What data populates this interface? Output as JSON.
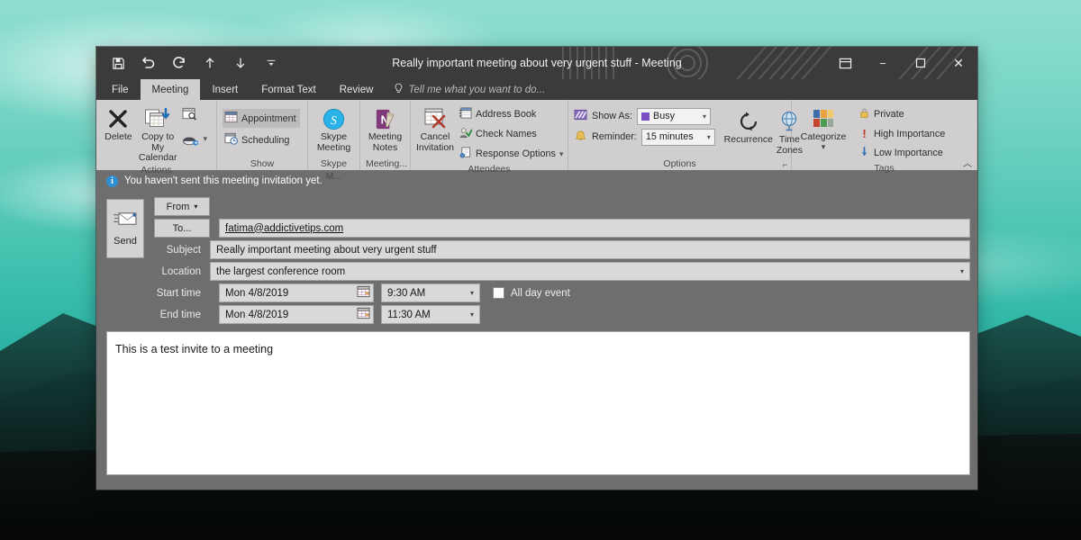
{
  "window": {
    "title": "Really important meeting about very urgent stuff - Meeting",
    "controls": {
      "ribbon_display_icon": "ribbon-display-options-icon",
      "minimize": "−",
      "maximize": "▢",
      "close": "✕"
    }
  },
  "quick_access": [
    {
      "name": "save-icon",
      "glyph": "save"
    },
    {
      "name": "undo-icon",
      "glyph": "undo"
    },
    {
      "name": "redo-icon",
      "glyph": "redo"
    },
    {
      "name": "previous-item-icon",
      "glyph": "up"
    },
    {
      "name": "next-item-icon",
      "glyph": "down"
    },
    {
      "name": "customize-quick-access-toolbar-icon",
      "glyph": "chevron"
    }
  ],
  "tabs": [
    {
      "label": "File",
      "active": false
    },
    {
      "label": "Meeting",
      "active": true
    },
    {
      "label": "Insert",
      "active": false
    },
    {
      "label": "Format Text",
      "active": false
    },
    {
      "label": "Review",
      "active": false
    }
  ],
  "tell_me": {
    "placeholder": "Tell me what you want to do..."
  },
  "ribbon": {
    "groups": [
      {
        "label": "Actions",
        "buttons": [
          {
            "label": "Delete",
            "icon": "delete-x-icon"
          },
          {
            "label": "Copy to My Calendar",
            "icon": "copy-to-calendar-icon"
          }
        ],
        "small": [
          {
            "label": "",
            "icon": "calendar-search-icon"
          },
          {
            "label": "",
            "icon": "forward-meeting-icon"
          }
        ]
      },
      {
        "label": "Show",
        "small": [
          {
            "label": "Appointment",
            "icon": "appointment-icon",
            "selected": true
          },
          {
            "label": "Scheduling",
            "icon": "scheduling-icon",
            "selected": false
          }
        ]
      },
      {
        "label": "Skype M...",
        "buttons": [
          {
            "label": "Skype Meeting",
            "icon": "skype-icon"
          }
        ]
      },
      {
        "label": "Meeting...",
        "buttons": [
          {
            "label": "Meeting Notes",
            "icon": "onenote-icon"
          }
        ]
      },
      {
        "label": "Attendees",
        "buttons": [
          {
            "label": "Cancel Invitation",
            "icon": "cancel-invitation-icon"
          }
        ],
        "small": [
          {
            "label": "Address Book",
            "icon": "address-book-icon"
          },
          {
            "label": "Check Names",
            "icon": "check-names-icon"
          },
          {
            "label": "Response Options",
            "icon": "response-options-icon",
            "dropdown": true
          }
        ]
      },
      {
        "label": "Options",
        "show_as": {
          "label": "Show As:",
          "value": "Busy",
          "icon": "show-as-icon",
          "swatch_color": "#7a4fc4"
        },
        "reminder": {
          "label": "Reminder:",
          "value": "15 minutes",
          "icon": "reminder-bell-icon"
        },
        "buttons": [
          {
            "label": "Recurrence",
            "icon": "recurrence-icon"
          },
          {
            "label": "Time Zones",
            "icon": "time-zones-icon"
          }
        ],
        "dialog_launcher": "options-dialog-launcher"
      },
      {
        "label": "Tags",
        "buttons": [
          {
            "label": "Categorize",
            "icon": "categorize-icon",
            "dropdown": true
          }
        ],
        "small": [
          {
            "label": "Private",
            "icon": "private-lock-icon"
          },
          {
            "label": "High Importance",
            "icon": "high-importance-icon"
          },
          {
            "label": "Low Importance",
            "icon": "low-importance-icon"
          }
        ]
      }
    ],
    "collapse_label": "collapse-ribbon-icon"
  },
  "info_bar": {
    "icon": "info-icon",
    "text": "You haven't sent this meeting invitation yet."
  },
  "form": {
    "send_button": {
      "label": "Send",
      "icon": "send-envelope-icon"
    },
    "from_button": {
      "label": "From",
      "dropdown": true
    },
    "to_button": {
      "label": "To..."
    },
    "to_value": "fatima@addictivetips.com",
    "subject_label": "Subject",
    "subject_value": "Really important meeting about very urgent stuff",
    "location_label": "Location",
    "location_value": "the largest conference room",
    "start_label": "Start time",
    "start_date": "Mon 4/8/2019",
    "start_time": "9:30 AM",
    "end_label": "End time",
    "end_date": "Mon 4/8/2019",
    "end_time": "11:30 AM",
    "all_day_label": "All day event",
    "all_day_checked": false
  },
  "body": {
    "text": "This is a test invite to a meeting"
  }
}
